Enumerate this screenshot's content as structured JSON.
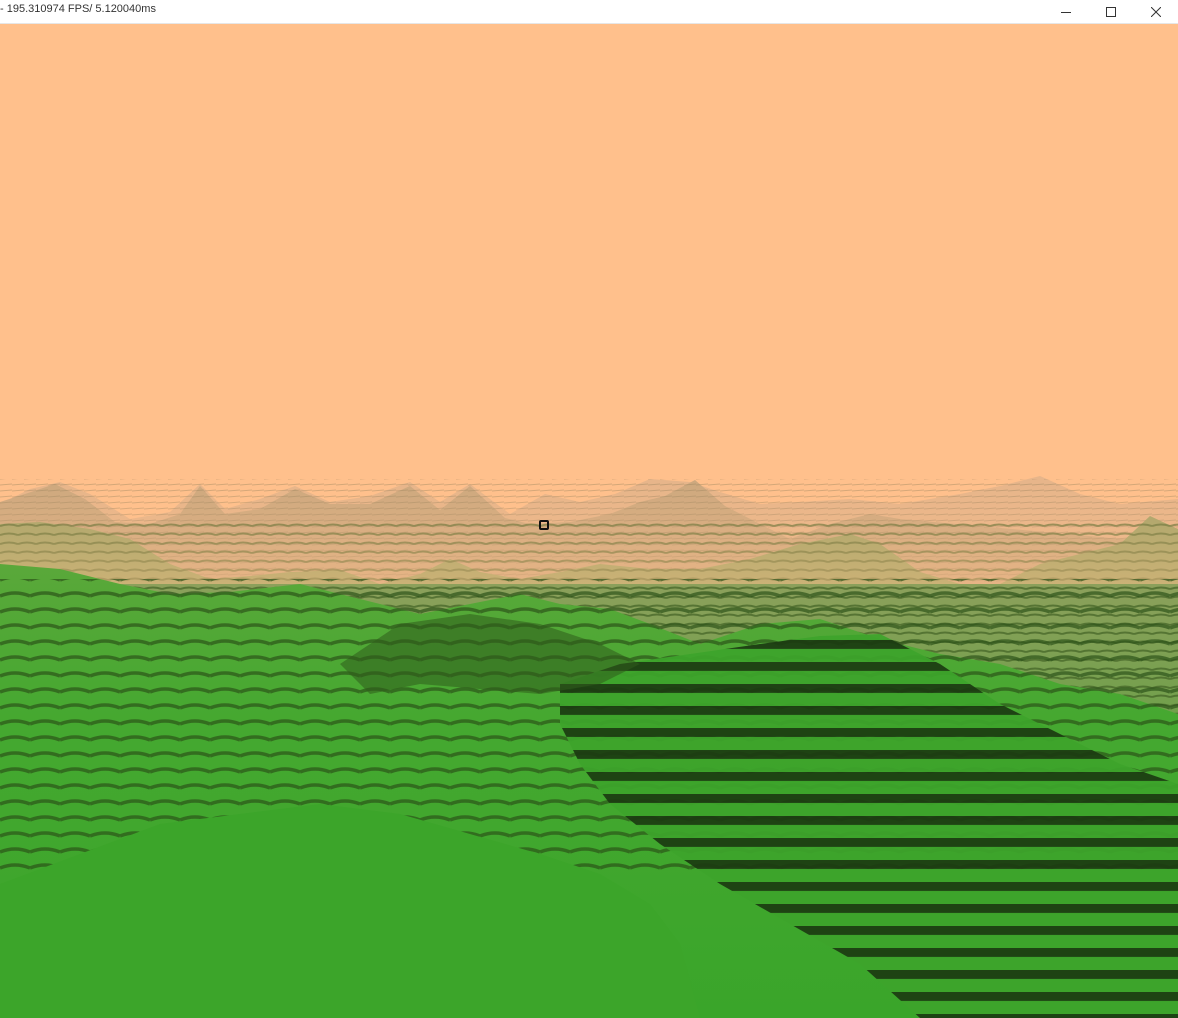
{
  "window": {
    "title": "- 195.310974 FPS/ 5.120040ms",
    "controls": {
      "minimize_icon": "minimize-icon",
      "maximize_icon": "maximize-icon",
      "close_icon": "close-icon"
    }
  },
  "scene": {
    "sky_color": "#ffc08c",
    "far_terrain_color": "#c9a67d",
    "mid_terrain_color": "#7f9a4a",
    "near_terrain_color": "#3da42b",
    "terrace_line_color": "#2f5b1c",
    "dark_block_color": "#1c3b12",
    "crosshair_icon": "crosshair-icon"
  }
}
